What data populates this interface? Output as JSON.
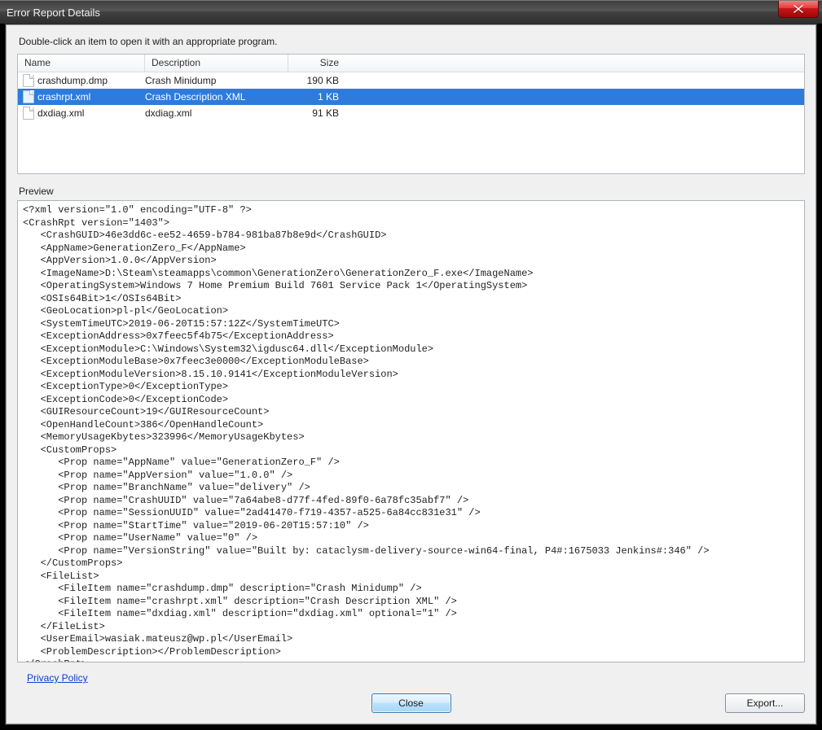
{
  "window": {
    "title": "Error Report Details"
  },
  "instruction": "Double-click an item to open it with an appropriate program.",
  "columns": {
    "name": "Name",
    "description": "Description",
    "size": "Size"
  },
  "files": [
    {
      "name": "crashdump.dmp",
      "description": "Crash Minidump",
      "size": "190 KB",
      "selected": false
    },
    {
      "name": "crashrpt.xml",
      "description": "Crash Description XML",
      "size": "1 KB",
      "selected": true
    },
    {
      "name": "dxdiag.xml",
      "description": "dxdiag.xml",
      "size": "91 KB",
      "selected": false
    }
  ],
  "preview_label": "Preview",
  "preview_text": "<?xml version=\"1.0\" encoding=\"UTF-8\" ?>\n<CrashRpt version=\"1403\">\n   <CrashGUID>46e3dd6c-ee52-4659-b784-981ba87b8e9d</CrashGUID>\n   <AppName>GenerationZero_F</AppName>\n   <AppVersion>1.0.0</AppVersion>\n   <ImageName>D:\\Steam\\steamapps\\common\\GenerationZero\\GenerationZero_F.exe</ImageName>\n   <OperatingSystem>Windows 7 Home Premium Build 7601 Service Pack 1</OperatingSystem>\n   <OSIs64Bit>1</OSIs64Bit>\n   <GeoLocation>pl-pl</GeoLocation>\n   <SystemTimeUTC>2019-06-20T15:57:12Z</SystemTimeUTC>\n   <ExceptionAddress>0x7feec5f4b75</ExceptionAddress>\n   <ExceptionModule>C:\\Windows\\System32\\igdusc64.dll</ExceptionModule>\n   <ExceptionModuleBase>0x7feec3e0000</ExceptionModuleBase>\n   <ExceptionModuleVersion>8.15.10.9141</ExceptionModuleVersion>\n   <ExceptionType>0</ExceptionType>\n   <ExceptionCode>0</ExceptionCode>\n   <GUIResourceCount>19</GUIResourceCount>\n   <OpenHandleCount>386</OpenHandleCount>\n   <MemoryUsageKbytes>323996</MemoryUsageKbytes>\n   <CustomProps>\n      <Prop name=\"AppName\" value=\"GenerationZero_F\" />\n      <Prop name=\"AppVersion\" value=\"1.0.0\" />\n      <Prop name=\"BranchName\" value=\"delivery\" />\n      <Prop name=\"CrashUUID\" value=\"7a64abe8-d77f-4fed-89f0-6a78fc35abf7\" />\n      <Prop name=\"SessionUUID\" value=\"2ad41470-f719-4357-a525-6a84cc831e31\" />\n      <Prop name=\"StartTime\" value=\"2019-06-20T15:57:10\" />\n      <Prop name=\"UserName\" value=\"0\" />\n      <Prop name=\"VersionString\" value=\"Built by: cataclysm-delivery-source-win64-final, P4#:1675033 Jenkins#:346\" />\n   </CustomProps>\n   <FileList>\n      <FileItem name=\"crashdump.dmp\" description=\"Crash Minidump\" />\n      <FileItem name=\"crashrpt.xml\" description=\"Crash Description XML\" />\n      <FileItem name=\"dxdiag.xml\" description=\"dxdiag.xml\" optional=\"1\" />\n   </FileList>\n   <UserEmail>wasiak.mateusz@wp.pl</UserEmail>\n   <ProblemDescription></ProblemDescription>\n</CrashRpt>",
  "footer": {
    "privacy": "Privacy Policy",
    "close": "Close",
    "export": "Export..."
  }
}
